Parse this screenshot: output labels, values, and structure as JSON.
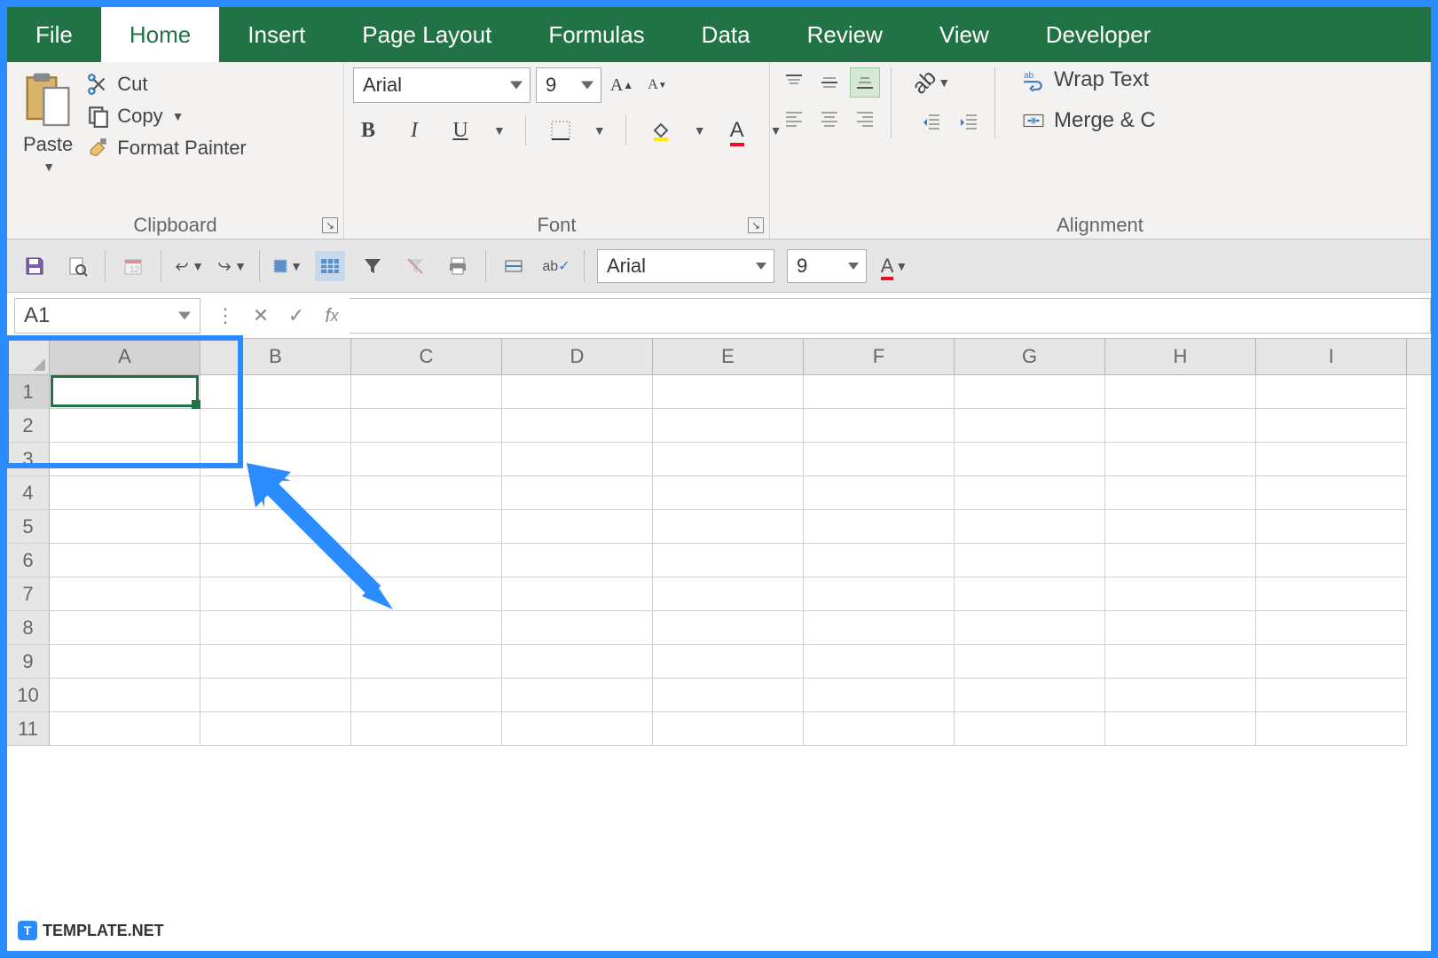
{
  "tabs": [
    "File",
    "Home",
    "Insert",
    "Page Layout",
    "Formulas",
    "Data",
    "Review",
    "View",
    "Developer"
  ],
  "active_tab": "Home",
  "clipboard": {
    "paste": "Paste",
    "cut": "Cut",
    "copy": "Copy",
    "format_painter": "Format Painter",
    "label": "Clipboard"
  },
  "font": {
    "name": "Arial",
    "size": "9",
    "label": "Font"
  },
  "alignment": {
    "label": "Alignment",
    "wrap": "Wrap Text",
    "merge": "Merge & C"
  },
  "qat": {
    "font_name": "Arial",
    "font_size": "9"
  },
  "name_box": "A1",
  "columns": [
    "A",
    "B",
    "C",
    "D",
    "E",
    "F",
    "G",
    "H",
    "I"
  ],
  "rows": [
    1,
    2,
    3,
    4,
    5,
    6,
    7,
    8,
    9,
    10,
    11
  ],
  "selected_cell": "A1",
  "watermark": "TEMPLATE.NET"
}
